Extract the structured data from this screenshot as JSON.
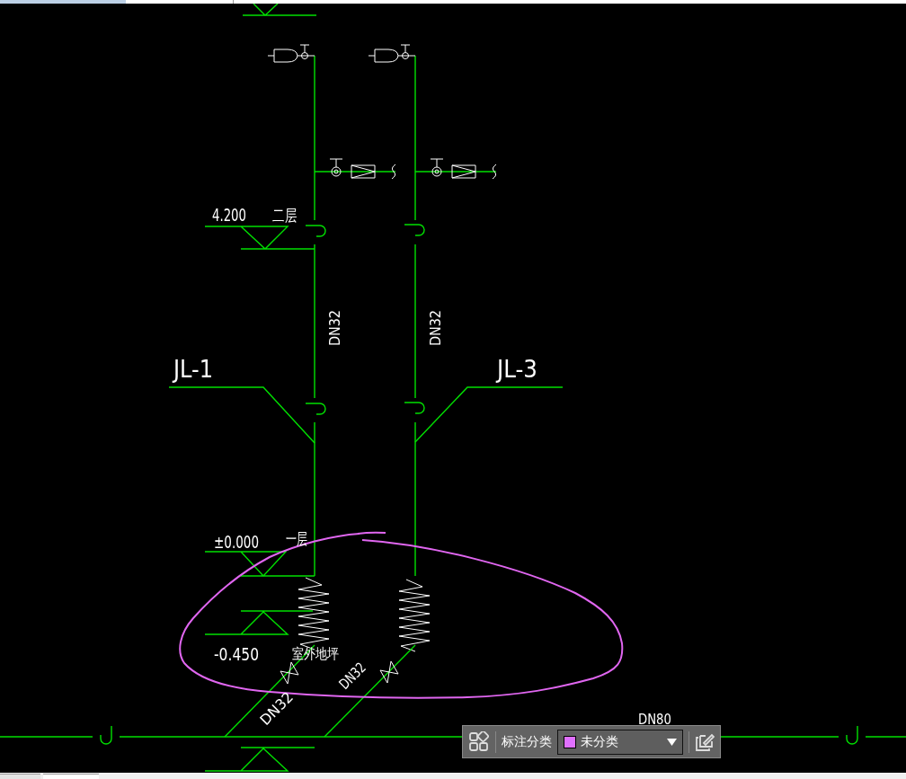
{
  "annotations": [
    {
      "kind": "elevation",
      "text": "4.200"
    },
    {
      "kind": "floor",
      "text": "二层"
    },
    {
      "kind": "pipe-size",
      "text": "DN32"
    },
    {
      "kind": "pipe-size",
      "text": "DN32"
    },
    {
      "kind": "riser-tag",
      "text": "JL-1"
    },
    {
      "kind": "riser-tag",
      "text": "JL-3"
    },
    {
      "kind": "elevation",
      "text": "±0.000"
    },
    {
      "kind": "floor",
      "text": "一层"
    },
    {
      "kind": "elevation",
      "text": "-0.450"
    },
    {
      "kind": "ground",
      "text": "室外地坪"
    },
    {
      "kind": "pipe-size",
      "text": "DN32"
    },
    {
      "kind": "pipe-size",
      "text": "DN32"
    },
    {
      "kind": "pipe-size",
      "text": "DN80"
    }
  ],
  "annotation_toolbar": {
    "label": "标注分类",
    "category": {
      "value": "未分类",
      "color": "#e070ff"
    }
  }
}
